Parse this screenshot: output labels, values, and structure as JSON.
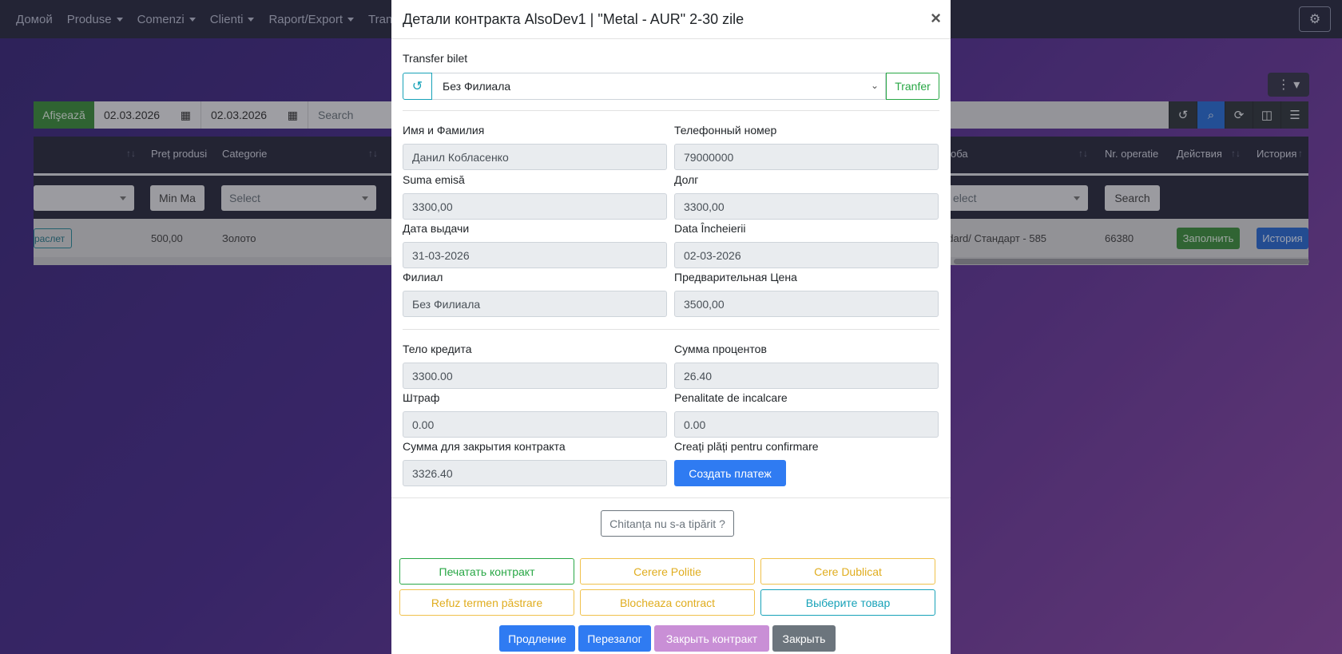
{
  "navbar": {
    "items": [
      {
        "label": "Домой",
        "dropdown": false
      },
      {
        "label": "Produse",
        "dropdown": true
      },
      {
        "label": "Comenzi",
        "dropdown": true
      },
      {
        "label": "Clienti",
        "dropdown": true
      },
      {
        "label": "Raport/Export",
        "dropdown": true
      },
      {
        "label": "Transfer B",
        "dropdown": false
      }
    ]
  },
  "toolbar": {
    "show_label": "Afişează",
    "date_from": "02.03.2026",
    "date_to": "02.03.2026",
    "search_placeholder": "Search"
  },
  "table": {
    "headers": {
      "pret": "Preț produsi",
      "categorie": "Categorie",
      "proba": "оба",
      "nr_operatie": "Nr. operatie",
      "actions": "Действия",
      "history": "История"
    },
    "filters": {
      "min_placeholder": "Min Ma",
      "category_select": "Select",
      "proba_select": "elect",
      "search_button": "Search"
    },
    "row": {
      "tag": "раслет",
      "price": "500,00",
      "category": "Золото",
      "proba": "ndard/ Стандарт - 585",
      "nr_operatie": "66380",
      "fill_button": "Заполнить",
      "history_button": "История"
    }
  },
  "modal": {
    "title": "Детали контракта AlsoDev1 | \"Metal - AUR\" 2-30 zile",
    "close": "×",
    "transfer": {
      "label": "Transfer bilet",
      "selected": "Без Филиала",
      "button": "Tranfer"
    },
    "fields": {
      "name_label": "Имя и Фамилия",
      "name_value": "Данил Кобласенко",
      "phone_label": "Телефонный номер",
      "phone_value": "79000000",
      "suma_label": "Suma emisă",
      "suma_value": "3300,00",
      "debt_label": "Долг",
      "debt_value": "3300,00",
      "issue_date_label": "Дата выдачи",
      "issue_date_value": "31-03-2026",
      "close_date_label": "Data Încheierii",
      "close_date_value": "02-03-2026",
      "branch_label": "Филиал",
      "branch_value": "Без Филиала",
      "prelim_price_label": "Предварительная Цена",
      "prelim_price_value": "3500,00",
      "credit_body_label": "Тело кредита",
      "credit_body_value": "3300.00",
      "interest_label": "Сумма процентов",
      "interest_value": "26.40",
      "fine_label": "Штраф",
      "fine_value": "0.00",
      "penalty_label": "Penalitate de incalcare",
      "penalty_value": "0.00",
      "close_sum_label": "Сумма для закрытия контракта",
      "close_sum_value": "3326.40",
      "create_payments_label": "Creați plăți pentru confirmare",
      "create_payment_button": "Создать платеж"
    },
    "receipt_button": "Chitanța nu s-a tipărit ?",
    "actions": {
      "print_contract": "Печатать контракт",
      "cerere_politie": "Cerere Politie",
      "cere_dublicat": "Cere Dublicat",
      "refuz": "Refuz termen păstrare",
      "blocheaza": "Blocheaza contract",
      "select_item": "Выберите товар"
    },
    "footer": {
      "extend": "Продление",
      "repledge": "Перезалог",
      "close_contract": "Закрыть контракт",
      "close": "Закрыть"
    }
  },
  "colors": {
    "primary": "#2f7bf2",
    "success": "#28a745",
    "warning": "#f0c14b",
    "info": "#17a2b8",
    "purple_btn": "#c98fd6",
    "gray_btn": "#6c757d"
  }
}
